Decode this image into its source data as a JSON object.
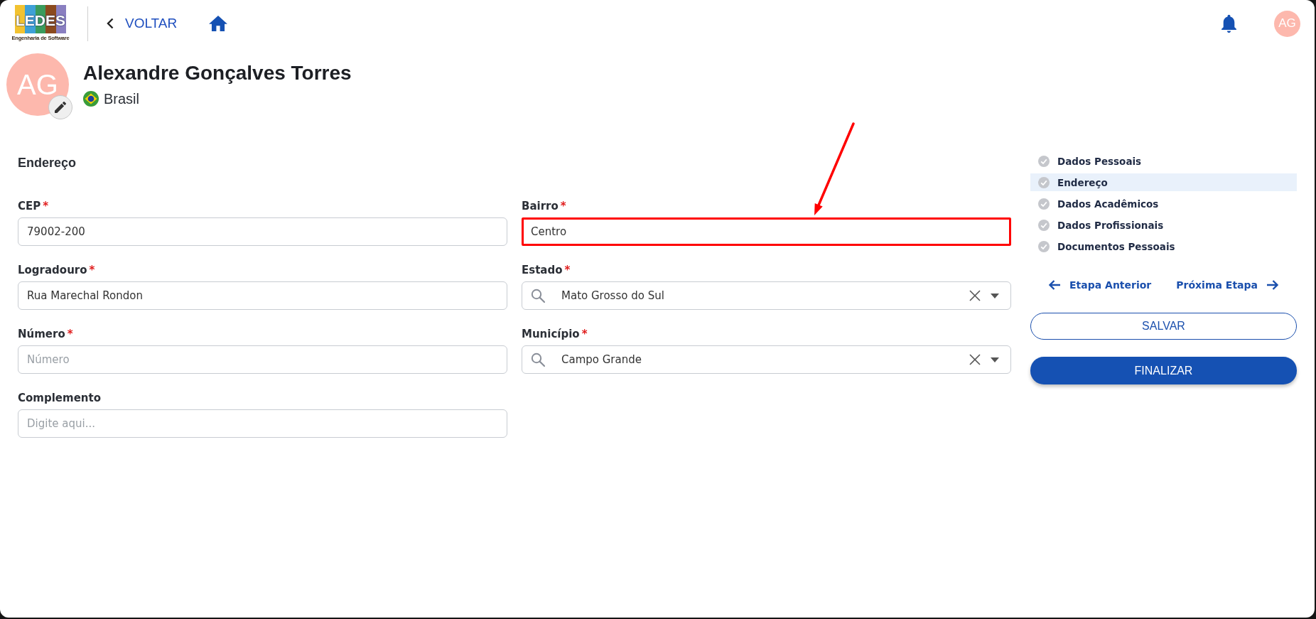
{
  "header": {
    "logo": {
      "title": "LEDES",
      "subtitle": "Engenharia de Software"
    },
    "back_link": "VOLTAR",
    "user_initials": "AG"
  },
  "profile": {
    "initials": "AG",
    "name": "Alexandre Gonçalves Torres",
    "country": "Brasil"
  },
  "form": {
    "title": "Endereço",
    "columns": [
      {
        "fields": [
          {
            "kind": "text",
            "label": "CEP",
            "required_mark": "*",
            "value": "79002-200",
            "highlighted": false
          },
          {
            "kind": "text",
            "label": "Logradouro",
            "required_mark": "*",
            "value": "Rua Marechal Rondon",
            "highlighted": false
          },
          {
            "kind": "text",
            "label": "Número",
            "required_mark": "*",
            "placeholder": "Número",
            "highlighted": false
          },
          {
            "kind": "text",
            "label": "Complemento",
            "placeholder": "Digite aqui...",
            "highlighted": false
          }
        ]
      },
      {
        "fields": [
          {
            "kind": "text",
            "label": "Bairro",
            "required_mark": "*",
            "value": "Centro",
            "highlighted": true
          },
          {
            "kind": "select",
            "label": "Estado",
            "required_mark": "*",
            "value": "Mato Grosso do Sul",
            "highlighted": false
          },
          {
            "kind": "select",
            "label": "Município",
            "required_mark": "*",
            "value": "Campo Grande",
            "highlighted": false
          }
        ]
      }
    ]
  },
  "steps": [
    {
      "label": "Dados Pessoais",
      "selected": false
    },
    {
      "label": "Endereço",
      "selected": true
    },
    {
      "label": "Dados Acadêmicos",
      "selected": false
    },
    {
      "label": "Dados Profissionais",
      "selected": false
    },
    {
      "label": "Documentos Pessoais",
      "selected": false
    }
  ],
  "navigation": {
    "previous": "Etapa Anterior",
    "next": "Próxima Etapa"
  },
  "buttons": [
    {
      "kind": "outline",
      "label": "SALVAR"
    },
    {
      "kind": "filled",
      "label": "FINALIZAR"
    }
  ]
}
